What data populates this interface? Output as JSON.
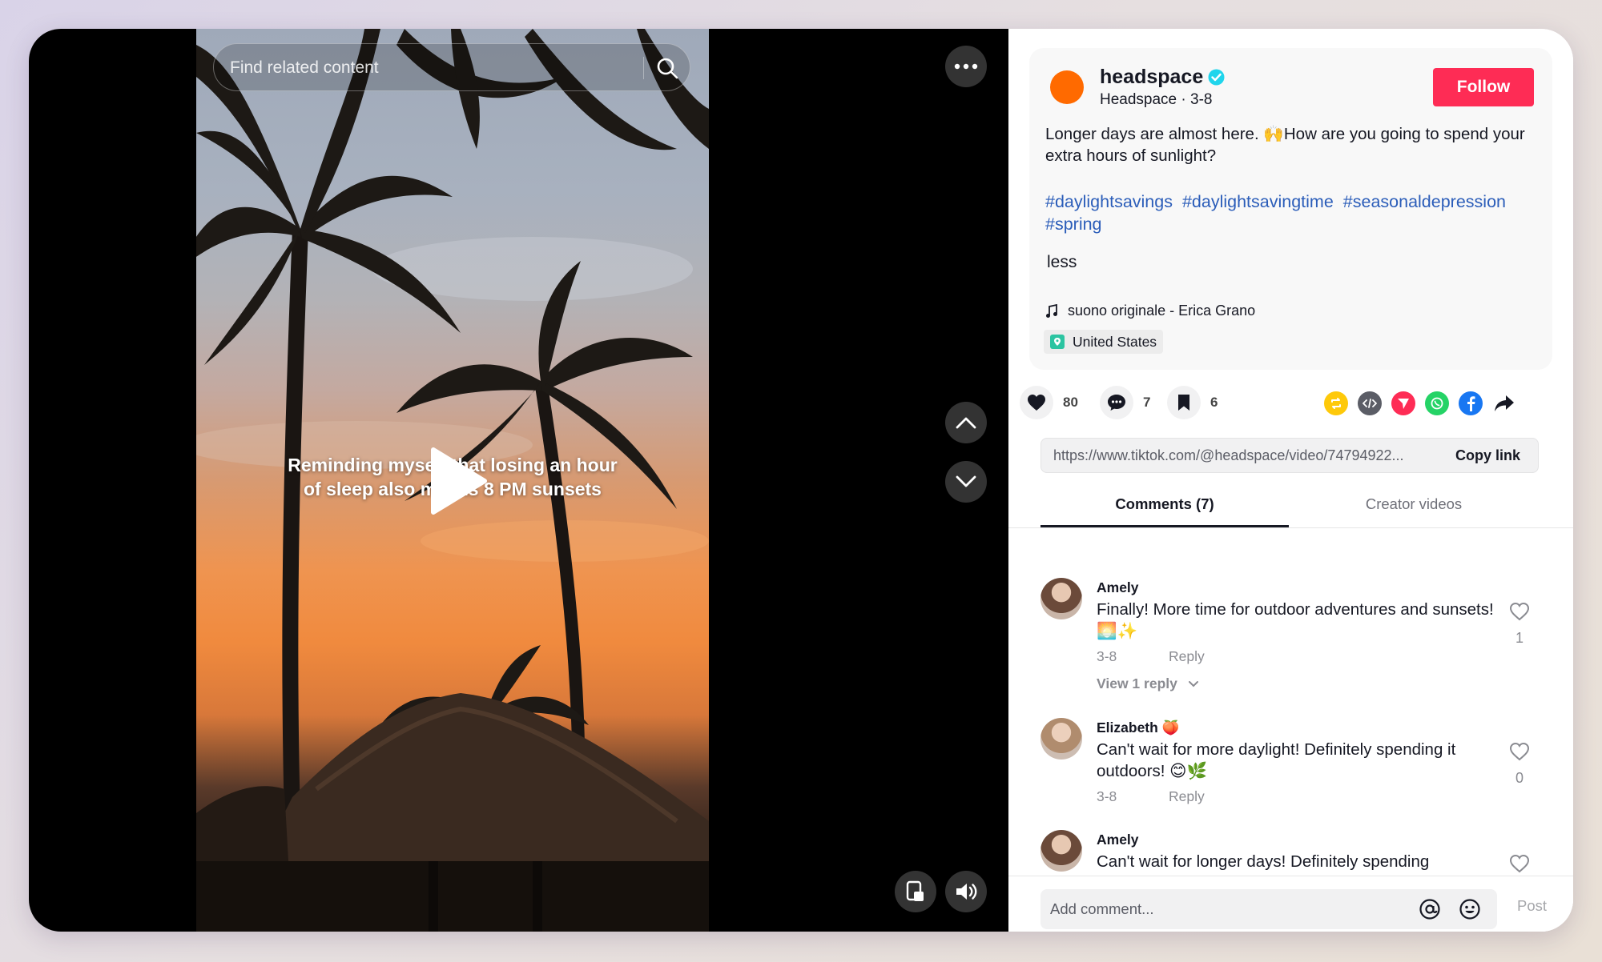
{
  "video": {
    "search_placeholder": "Find related content",
    "caption_line1": "Reminding myself that losing an hour",
    "caption_line2": "of sleep also means 8 PM sunsets",
    "icons": {
      "search": "search-icon",
      "more": "more-dots-icon",
      "up": "chevron-up-icon",
      "down": "chevron-down-icon",
      "play": "play-icon",
      "mini_player": "mini-player-icon",
      "volume": "volume-icon"
    }
  },
  "post": {
    "author_name": "headspace",
    "author_sub": "Headspace · 3-8",
    "follow_label": "Follow",
    "description": "Longer days are almost here. 🙌How are you going to spend your extra hours of sunlight?",
    "hashtags": [
      "#daylightsavings",
      "#daylightsavingtime",
      "#seasonaldepression",
      "#spring"
    ],
    "less_label": "less",
    "music": "suono originale - Erica Grano",
    "location": "United States",
    "accent_color": "#fe2c55",
    "hashtag_color": "#2b5db9"
  },
  "actions": {
    "likes": "80",
    "comments": "7",
    "saves": "6",
    "share_targets": [
      "repost-icon",
      "embed-icon",
      "send-icon",
      "whatsapp-icon",
      "facebook-icon",
      "share-arrow-icon"
    ]
  },
  "link": {
    "url": "https://www.tiktok.com/@headspace/video/74794922...",
    "copy_label": "Copy link"
  },
  "tabs": {
    "comments": "Comments (7)",
    "creator_videos": "Creator videos"
  },
  "comments": [
    {
      "name": "Amely",
      "text": "Finally! More time for outdoor adventures and sunsets! 🌅✨",
      "date": "3-8",
      "reply": "Reply",
      "likes": "1",
      "view_replies": "View 1 reply"
    },
    {
      "name": "Elizabeth 🍑",
      "text": "Can't wait for more daylight! Definitely spending it outdoors! 😊🌿",
      "date": "3-8",
      "reply": "Reply",
      "likes": "0"
    },
    {
      "name": "Amely",
      "text": "Can't wait for longer days! Definitely spending"
    }
  ],
  "composer": {
    "placeholder": "Add comment...",
    "post_label": "Post"
  }
}
